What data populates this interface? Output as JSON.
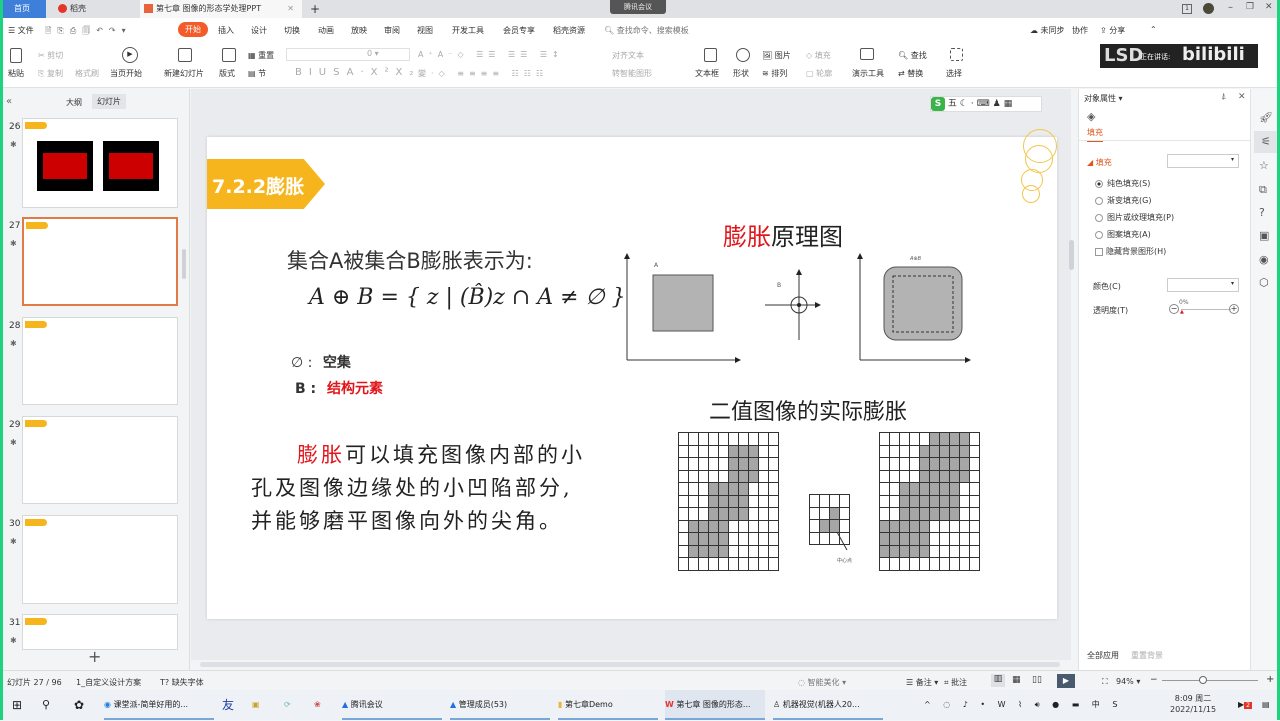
{
  "tabs": [
    {
      "label": "首页",
      "active": false
    },
    {
      "label": "稻壳",
      "active": false
    },
    {
      "label": "第七章 图像的形态学处理PPT",
      "active": true
    }
  ],
  "meeting_badge": "腾讯会议",
  "menu": {
    "file": "文件",
    "items": [
      "开始",
      "插入",
      "设计",
      "切换",
      "动画",
      "放映",
      "审阅",
      "视图",
      "开发工具",
      "会员专享",
      "稻壳资源"
    ],
    "active": "开始",
    "search_placeholder": "查找命令、搜索模板",
    "sync": "未同步",
    "collab": "协作",
    "share": "分享"
  },
  "ribbon": {
    "paste": "粘贴",
    "cut": "剪切",
    "copy": "复制",
    "format_painter": "格式刷",
    "play_from_current": "当页开始",
    "new_slide": "新建幻灯片",
    "layout": "版式",
    "section": "节",
    "reset": "重置",
    "font_size": "0",
    "align_text": "对齐文本",
    "smartart": "转智能图形",
    "textbox": "文本框",
    "shape": "形状",
    "picture": "图片",
    "fill": "填充",
    "arrange": "排列",
    "outline": "轮廓",
    "present_tools": "演示工具",
    "find": "查找",
    "replace": "替换",
    "select": "选择"
  },
  "overlay_logo": "bilibili",
  "overlay_text": "正在讲话:",
  "left_panel": {
    "tab_outline": "大纲",
    "tab_slides": "幻灯片",
    "active_tab": "幻灯片",
    "slides": [
      {
        "num": "26"
      },
      {
        "num": "27",
        "selected": true
      },
      {
        "num": "28"
      },
      {
        "num": "29"
      },
      {
        "num": "30"
      },
      {
        "num": "31"
      }
    ],
    "add_icon": "plus-icon"
  },
  "ime_toolbar": {
    "label": "五"
  },
  "slide": {
    "section_title": "7.2.2膨胀",
    "heading": "集合A被集合B膨胀表示为:",
    "formula": "A ⊕ B = { z | (B̂)z ∩ A ≠ ∅ }",
    "legend": [
      {
        "symbol": "∅ :",
        "text": "空集",
        "color": "#333333"
      },
      {
        "symbol": "B :",
        "text": "结构元素",
        "color": "#e0161b"
      }
    ],
    "desc_highlight": "膨胀",
    "desc_lines": [
      "可以填充图像内部的小",
      "孔及图像边缘处的小凹陷部分,",
      "并能够磨平图像向外的尖角。"
    ],
    "diagram_title_red": "膨胀",
    "diagram_title_rest": "原理图",
    "label_a": "A",
    "label_b": "B",
    "label_ab": "A⊕B",
    "grid_title": "二值图像的实际膨胀",
    "center_label": "中心点",
    "grid_a": [
      "0000000000",
      "0000011100",
      "0000011100",
      "0000011100",
      "0001111000",
      "0001111000",
      "0001111000",
      "0111100000",
      "0111100000",
      "0111100000",
      "0000000000"
    ],
    "grid_b": [
      "0000",
      "0010",
      "0110",
      "0000"
    ],
    "grid_result": [
      "0000011110",
      "0000111110",
      "0000111110",
      "0000111110",
      "0011111100",
      "0011111100",
      "0011111100",
      "1111100000",
      "1111100000",
      "1111100000",
      "0000000000"
    ],
    "colors": {
      "accent": "#f6b51c",
      "red": "#e0161b",
      "fill_gray": "#a6a6a6"
    }
  },
  "right_panel": {
    "title": "对象属性",
    "tab": "填充",
    "section": "填充",
    "options": [
      {
        "label": "纯色填充(S)",
        "checked": true
      },
      {
        "label": "渐变填充(G)",
        "checked": false
      },
      {
        "label": "图片或纹理填充(P)",
        "checked": false
      },
      {
        "label": "图案填充(A)",
        "checked": false
      }
    ],
    "hide_bg": "隐藏背景图形(H)",
    "color_label": "颜色(C)",
    "transparency_label": "透明度(T)",
    "transparency_value": "0%",
    "apply_all": "全部应用",
    "reset_bg": "重置背景"
  },
  "status": {
    "slide_count": "幻灯片 27 / 96",
    "theme": "1_自定义设计方案",
    "missing_font": "缺失字体",
    "beautify": "智能美化",
    "notes": "备注",
    "comment": "批注",
    "zoom": "94%",
    "zoom_value": 94
  },
  "taskbar": {
    "items": [
      "课堂派-简单好用的...",
      "腾讯会议",
      "管理成员(53)",
      "第七章Demo",
      "第七章 图像的形态...",
      "机器视觉(机器人20..."
    ],
    "time": "8:09 周二",
    "date": "2022/11/15",
    "notif_count": "2"
  }
}
